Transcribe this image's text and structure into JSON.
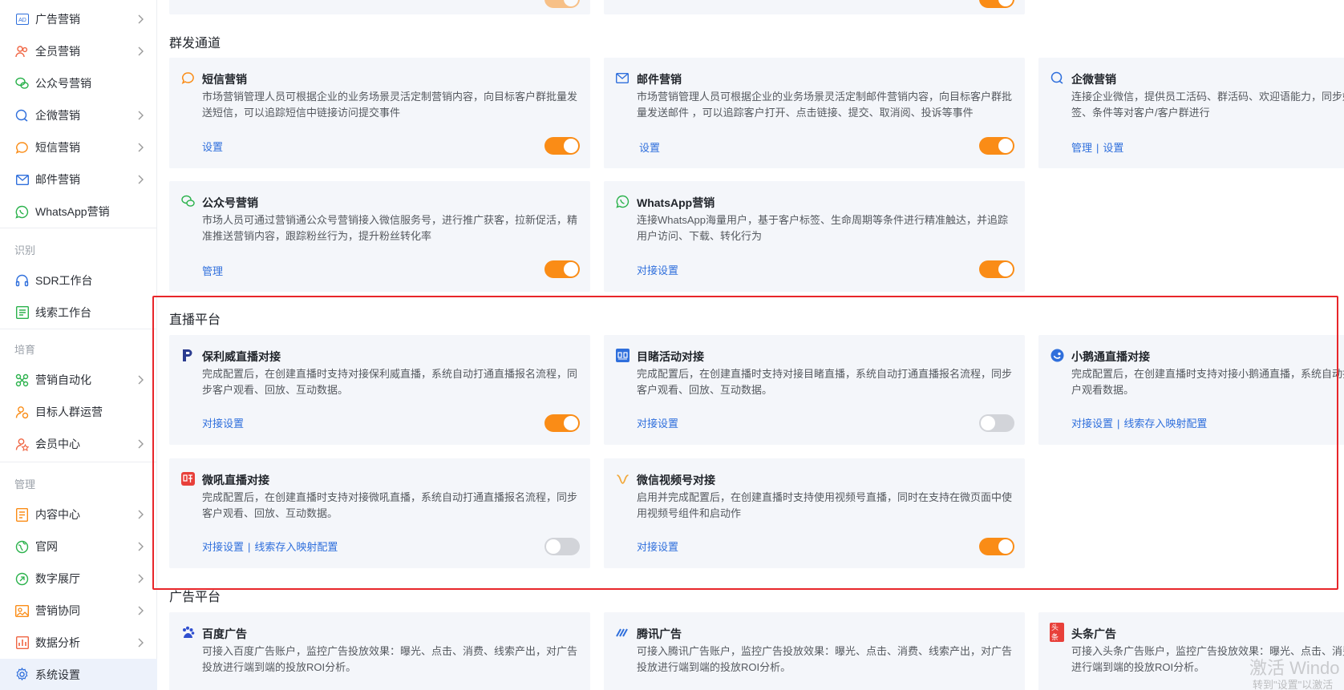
{
  "sidebar": {
    "items": [
      {
        "label": "广告营销",
        "icon": "ad-icon"
      },
      {
        "label": "全员营销",
        "icon": "people-icon"
      },
      {
        "label": "公众号营销",
        "icon": "wechat-icon"
      },
      {
        "label": "企微营销",
        "icon": "wecom-icon"
      },
      {
        "label": "短信营销",
        "icon": "sms-icon"
      },
      {
        "label": "邮件营销",
        "icon": "mail-icon"
      },
      {
        "label": "WhatsApp营销",
        "icon": "whatsapp-icon"
      },
      {
        "label": "SDR工作台",
        "icon": "headset-icon"
      },
      {
        "label": "线索工作台",
        "icon": "clue-icon"
      },
      {
        "label": "营销自动化",
        "icon": "automation-icon"
      },
      {
        "label": "目标人群运营",
        "icon": "target-people-icon"
      },
      {
        "label": "会员中心",
        "icon": "member-icon"
      },
      {
        "label": "内容中心",
        "icon": "content-icon"
      },
      {
        "label": "官网",
        "icon": "globe-icon"
      },
      {
        "label": "数字展厅",
        "icon": "hall-icon"
      },
      {
        "label": "营销协同",
        "icon": "collab-icon"
      },
      {
        "label": "数据分析",
        "icon": "chart-icon"
      },
      {
        "label": "系统设置",
        "icon": "gear-icon"
      }
    ],
    "groups": {
      "identify": "识别",
      "nurture": "培育",
      "manage": "管理"
    }
  },
  "sections": {
    "mass": "群发通道",
    "live": "直播平台",
    "ads": "广告平台"
  },
  "cards": {
    "sms": {
      "title": "短信营销",
      "desc": "市场营销管理人员可根据企业的业务场景灵活定制营销内容，向目标客户群批量发送短信，可以追踪短信中链接访问提交事件",
      "link1": "设置"
    },
    "email": {
      "title": "邮件营销",
      "desc": "市场营销管理人员可根据企业的业务场景灵活定制邮件营销内容，向目标客户群批量发送邮件 ，可以追踪客户打开、点击链接、提交、取消阅、投诉等事件",
      "link1": "设置"
    },
    "wecom": {
      "title": "企微营销",
      "desc": "连接企业微信，提供员工活码、群活码、欢迎语能力，同步好友及客户群，支持按标签、条件等对客户/客户群进行",
      "link1": "管理",
      "link2": "设置"
    },
    "official": {
      "title": "公众号营销",
      "desc": "市场人员可通过营销通公众号营销接入微信服务号，进行推广获客，拉新促活，精准推送营销内容，跟踪粉丝行为，提升粉丝转化率",
      "link1": "管理"
    },
    "whatsapp": {
      "title": "WhatsApp营销",
      "desc": "连接WhatsApp海量用户，基于客户标签、生命周期等条件进行精准触达，并追踪用户访问、下载、转化行为",
      "link1": "对接设置"
    },
    "polyv": {
      "title": "保利威直播对接",
      "desc": "完成配置后，在创建直播时支持对接保利威直播，系统自动打通直播报名流程，同步客户观看、回放、互动数据。",
      "link1": "对接设置"
    },
    "mudu": {
      "title": "目睹活动对接",
      "desc": "完成配置后，在创建直播时支持对接目睹直播，系统自动打通直播报名流程，同步客户观看、回放、互动数据。",
      "link1": "对接设置"
    },
    "xiaoe": {
      "title": "小鹅通直播对接",
      "desc": "完成配置后，在创建直播时支持对接小鹅通直播，系统自动打通直播报名流程，同步客户观看数据。",
      "link1": "对接设置",
      "link2": "线索存入映射配置"
    },
    "vhall": {
      "title": "微吼直播对接",
      "desc": "完成配置后，在创建直播时支持对接微吼直播，系统自动打通直播报名流程，同步客户观看、回放、互动数据。",
      "link1": "对接设置",
      "link2": "线索存入映射配置"
    },
    "channels": {
      "title": "微信视频号对接",
      "desc": "启用并完成配置后，在创建直播时支持使用视频号直播，同时在支持在微页面中使用视频号组件和启动作",
      "link1": "对接设置"
    },
    "baidu": {
      "title": "百度广告",
      "desc": "可接入百度广告账户，监控广告投放效果：曝光、点击、消费、线索产出，对广告投放进行端到端的投放ROI分析。"
    },
    "tencent": {
      "title": "腾讯广告",
      "desc": "可接入腾讯广告账户，监控广告投放效果：曝光、点击、消费、线索产出，对广告投放进行端到端的投放ROI分析。"
    },
    "toutiao": {
      "title": "头条广告",
      "desc": "可接入头条广告账户，监控广告投放效果：曝光、点击、消费、线索产出，对广告投放进行端到端的投放ROI分析。",
      "badge": "头条"
    }
  },
  "toggles": {
    "sms": "on",
    "email": "on",
    "official": "on",
    "whatsapp": "on",
    "polyv": "on",
    "mudu": "off",
    "vhall": "off",
    "channels": "on"
  },
  "colors": {
    "accent": "#fa8c16",
    "link": "#2f6fdc",
    "highlight": "#e8262a",
    "card": "#f4f6fa"
  },
  "watermark": {
    "line1": "激活 Windo",
    "line2": "转到\"设置\"以激活"
  }
}
